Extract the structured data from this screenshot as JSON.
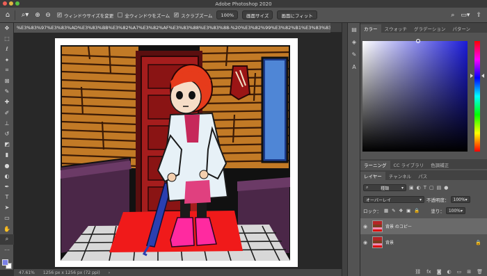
{
  "window": {
    "title": "Adobe Photoshop 2020"
  },
  "options_bar": {
    "resize_windows_label": "ウィンドウサイズを変更",
    "zoom_all_label": "全ウィンドウをズーム",
    "scrubby_zoom_label": "スクラブズーム",
    "zoom_value": "100%",
    "fit_screen_label": "画面サイズ",
    "fill_screen_label": "画面にフィット"
  },
  "document": {
    "tab_title": "%E3%83%97%E3%83%AD%E3%83%BB%E3%82%A7%E3%82%AF%E3%83%88%E3%83%88-%20%E3%82%99%E3%82%B1%E3%83%83%E3%83%88%20",
    "zoom_status": "47.61%",
    "dimensions": "1256 px x 1256 px (72 ppi)"
  },
  "color_panel": {
    "tabs": [
      "カラー",
      "スウォッチ",
      "グラデーション",
      "パターン"
    ],
    "accent_fg": "#7a80e8"
  },
  "learn_panel": {
    "tabs": [
      "ラーニング",
      "CC ライブラリ",
      "色調補正"
    ]
  },
  "layers_panel": {
    "tabs": [
      "レイヤー",
      "チャンネル",
      "パス"
    ],
    "filter_kind": "種類",
    "blend_mode": "オーバーレイ",
    "opacity_label": "不透明度：",
    "opacity_value": "100%",
    "lock_label": "ロック：",
    "fill_label": "塗り：",
    "fill_value": "100%",
    "layers": [
      {
        "name": "背景 のコピー",
        "selected": true,
        "locked": false
      },
      {
        "name": "背景",
        "selected": false,
        "locked": true
      }
    ]
  }
}
